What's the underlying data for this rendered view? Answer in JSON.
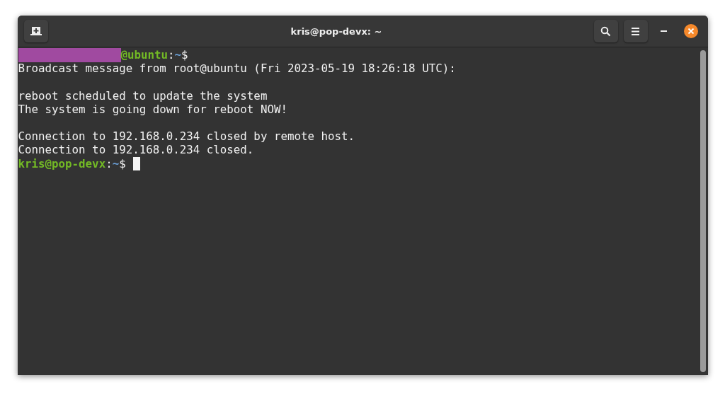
{
  "window": {
    "title": "kris@pop-devx: ~"
  },
  "terminal": {
    "lines": [
      {
        "kind": "prompt",
        "redacted": true,
        "user": "@ubuntu",
        "sep": ":",
        "path": "~",
        "symbol": "$",
        "cursor": false
      },
      {
        "kind": "text",
        "text": "Broadcast message from root@ubuntu (Fri 2023-05-19 18:26:18 UTC):"
      },
      {
        "kind": "blank"
      },
      {
        "kind": "text",
        "text": "reboot scheduled to update the system"
      },
      {
        "kind": "text",
        "text": "The system is going down for reboot NOW!"
      },
      {
        "kind": "blank"
      },
      {
        "kind": "text",
        "text": "Connection to 192.168.0.234 closed by remote host."
      },
      {
        "kind": "text",
        "text": "Connection to 192.168.0.234 closed."
      },
      {
        "kind": "prompt",
        "redacted": false,
        "user": "kris@pop-devx",
        "sep": ":",
        "path": "~",
        "symbol": "$",
        "cursor": true
      }
    ]
  }
}
